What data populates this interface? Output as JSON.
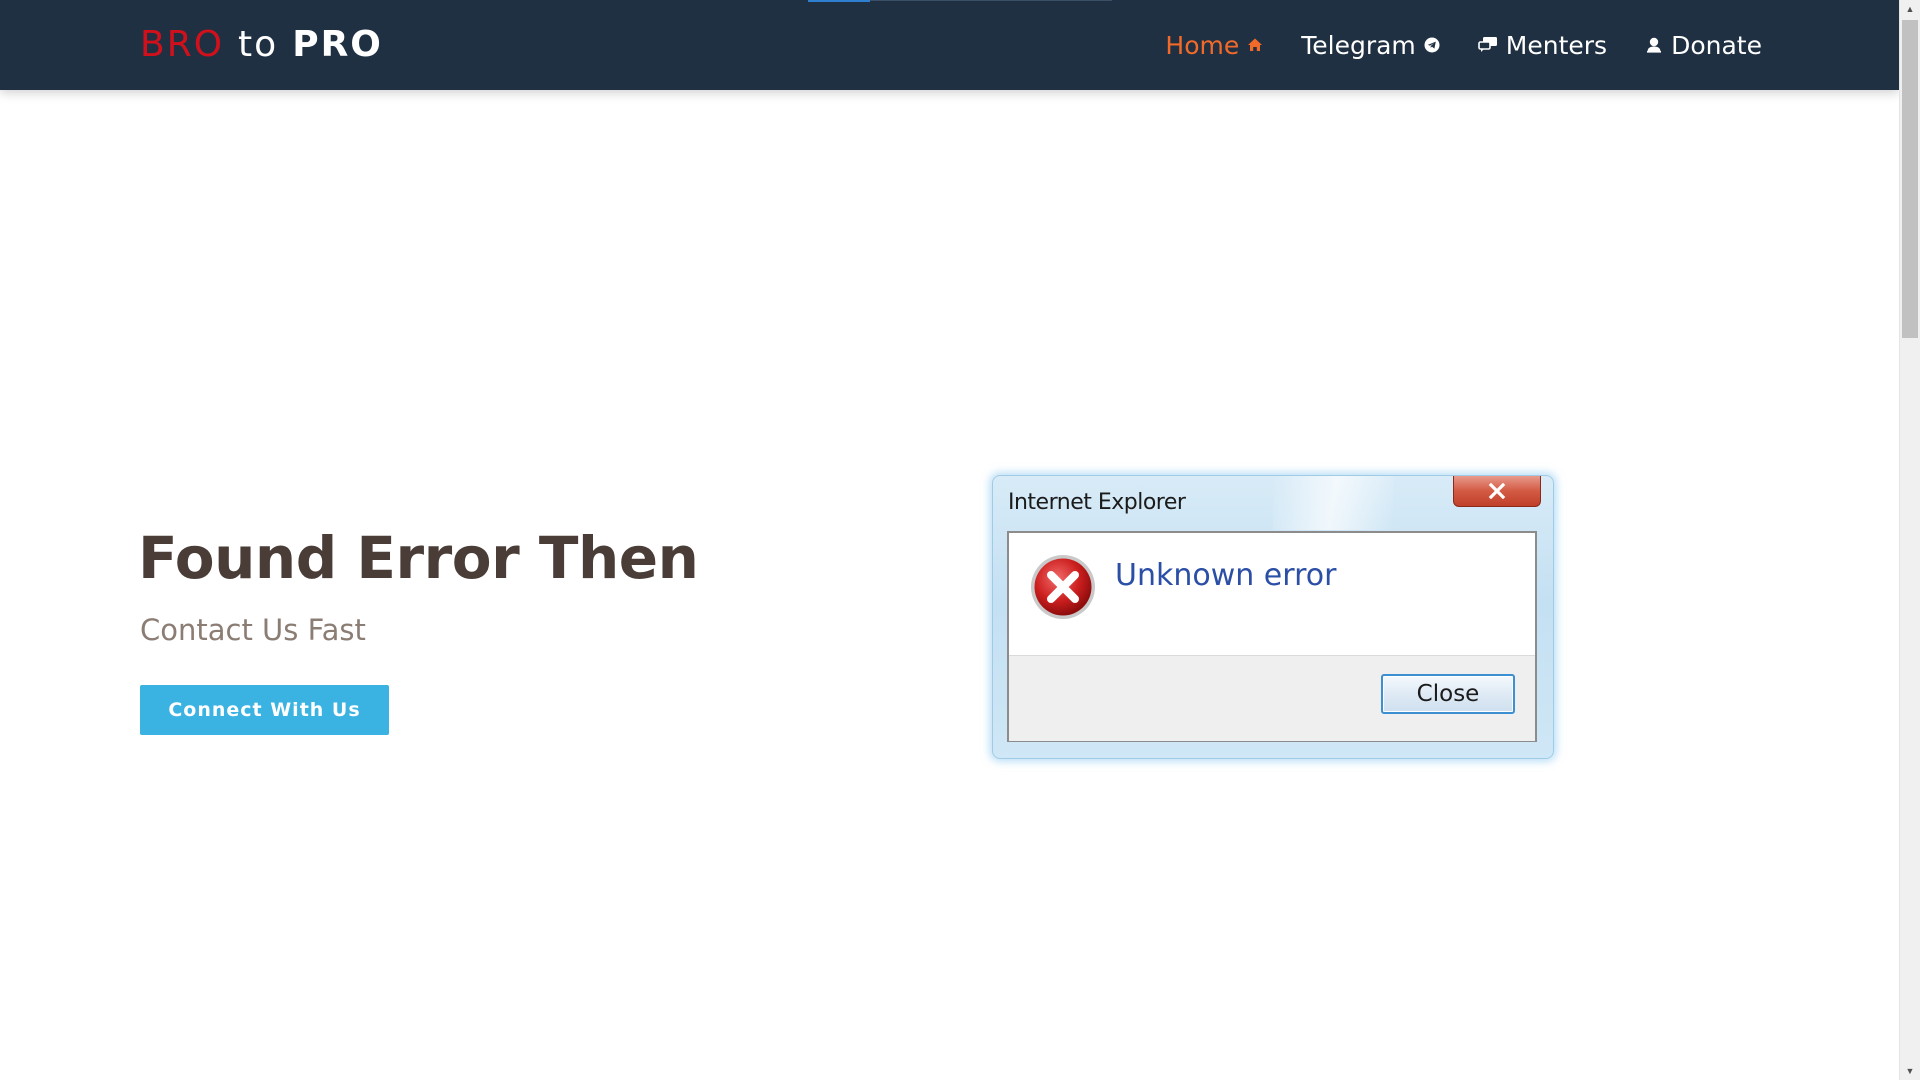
{
  "navbar": {
    "brand": {
      "part1": "BRO",
      "part2": "to",
      "part3": "PRO",
      "colors": {
        "accent": "#d0111c",
        "text": "#ffffff",
        "background": "#1f3042"
      }
    },
    "items": [
      {
        "label": "Home",
        "icon": "home-icon",
        "active": true
      },
      {
        "label": "Telegram",
        "icon": "telegram-icon",
        "active": false
      },
      {
        "label": "Menters",
        "icon": "chat-icon",
        "active": false
      },
      {
        "label": "Donate",
        "icon": "user-icon",
        "active": false
      }
    ],
    "active_color": "#f26a2a"
  },
  "hero": {
    "title": "Found Error Then",
    "subtitle": "Contact Us Fast",
    "cta_label": "Connect With Us",
    "cta_color": "#3bb3e2"
  },
  "error_dialog": {
    "window_title": "Internet Explorer",
    "message": "Unknown error",
    "button_label": "Close",
    "icon": "error-icon",
    "message_color": "#2b4fa6"
  },
  "scrollbar": {
    "up_arrow": "▲",
    "down_arrow": "▼"
  }
}
